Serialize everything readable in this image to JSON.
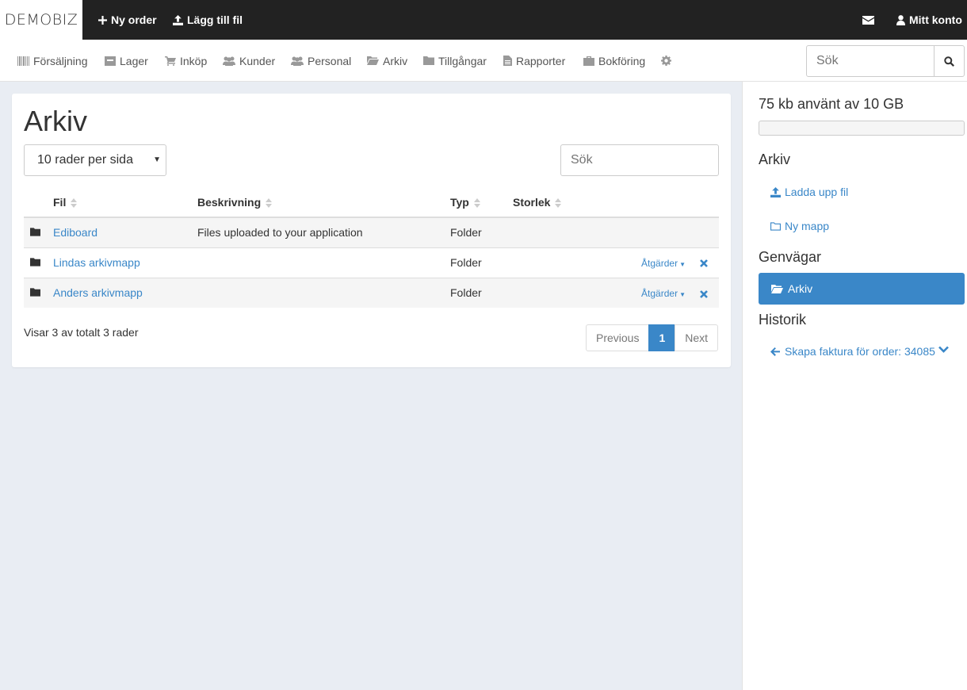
{
  "topbar": {
    "brand": "DEMOBIZ",
    "new_order": "Ny order",
    "add_file": "Lägg till fil",
    "account": "Mitt konto"
  },
  "nav": {
    "items": [
      "Försäljning",
      "Lager",
      "Inköp",
      "Kunder",
      "Personal",
      "Arkiv",
      "Tillgångar",
      "Rapporter",
      "Bokföring"
    ],
    "search_placeholder": "Sök"
  },
  "main": {
    "title": "Arkiv",
    "rows_per_page": "10 rader per sida",
    "search_placeholder": "Sök",
    "columns": [
      "Fil",
      "Beskrivning",
      "Typ",
      "Storlek"
    ],
    "rows": [
      {
        "name": "Ediboard",
        "description": "Files uploaded to your application",
        "type": "Folder",
        "size": "",
        "actions": ""
      },
      {
        "name": "Lindas arkivmapp",
        "description": "",
        "type": "Folder",
        "size": "",
        "actions": "Åtgärder"
      },
      {
        "name": "Anders arkivmapp",
        "description": "",
        "type": "Folder",
        "size": "",
        "actions": "Åtgärder"
      }
    ],
    "row_count_text": "Visar 3 av totalt 3 rader",
    "pagination": {
      "previous": "Previous",
      "current": "1",
      "next": "Next"
    }
  },
  "sidebar": {
    "storage_text": "75 kb använt av 10 GB",
    "storage_fraction": 0,
    "archive_heading": "Arkiv",
    "upload_link": "Ladda upp fil",
    "new_folder_link": "Ny mapp",
    "shortcuts_heading": "Genvägar",
    "shortcut_item": "Arkiv",
    "history_heading": "Historik",
    "history_item": "Skapa faktura för order: 34085"
  },
  "colors": {
    "accent": "#3a87c8",
    "topbar_bg": "#222222",
    "page_bg": "#e9edf3"
  }
}
